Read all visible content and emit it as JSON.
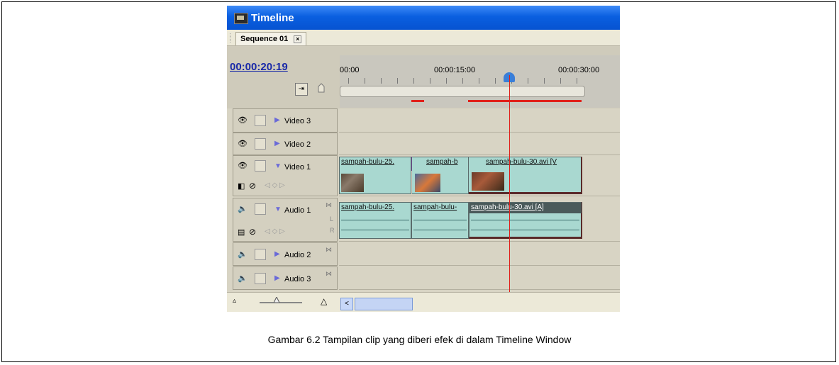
{
  "window": {
    "title": "Timeline"
  },
  "tab": {
    "label": "Sequence 01",
    "close": "×"
  },
  "timecode": "00:00:20:19",
  "ruler": {
    "labels": [
      "00:00",
      "00:00:15:00",
      "00:00:30:00"
    ]
  },
  "tracks": {
    "video3": "Video 3",
    "video2": "Video 2",
    "video1": "Video 1",
    "audio1": "Audio 1",
    "audio2": "Audio 2",
    "audio3": "Audio 3",
    "audio_lr": [
      "L",
      "R"
    ]
  },
  "clips": {
    "v1": [
      "sampah-bulu-25.",
      "sampah-b",
      "sampah-bulu-30.avi [V"
    ],
    "a1": [
      "sampah-bulu-25.",
      "sampah-bulu-",
      "sampah-bulu-30.avi [A]"
    ]
  },
  "caption": "Gambar 6.2 Tampilan clip yang diberi efek di dalam Timeline Window",
  "colors": {
    "titlebar": "#0a5fe0",
    "playhead": "#e0201a",
    "clip": "#a9d8d0",
    "timecode": "#1a2aa8"
  },
  "icons": [
    "eye-icon",
    "speaker-icon",
    "snap-icon",
    "marker-icon",
    "expand-triangle-icon",
    "collapse-triangle-icon",
    "transition-icon"
  ]
}
